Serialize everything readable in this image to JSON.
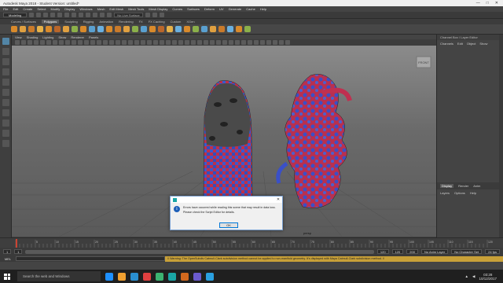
{
  "window": {
    "title": "Autodesk Maya 2018 - Student Version: untitled*",
    "controls": [
      "—",
      "□",
      "✕"
    ]
  },
  "menubar": {
    "items": [
      "File",
      "Edit",
      "Create",
      "Select",
      "Modify",
      "Display",
      "Windows",
      "Mesh",
      "Edit Mesh",
      "Mesh Tools",
      "Mesh Display",
      "Curves",
      "Surfaces",
      "Deform",
      "UV",
      "Generate",
      "Cache",
      "Help"
    ]
  },
  "statusline": {
    "mode": "Modeling",
    "live_surface": "No Live Surface"
  },
  "shelf": {
    "tabs": [
      "Curves / Surfaces",
      "Polygons",
      "Sculpting",
      "Rigging",
      "Animation",
      "Rendering",
      "FX",
      "FX Caching",
      "Custom",
      "XGen"
    ],
    "active_tab": "Polygons",
    "icon_colors": [
      "#d98a2b",
      "#e0a040",
      "#c97a2a",
      "#e6b24a",
      "#d98a2b",
      "#b9662a",
      "#e0a040",
      "#8bb04a",
      "#d98a2b",
      "#5aa0d0",
      "#6ab0e0",
      "#d98a2b",
      "#c97a2a",
      "#e0a040",
      "#8bb04a",
      "#5aa0d0",
      "#d98a2b",
      "#b9662a",
      "#e6b24a",
      "#6ab0e0",
      "#d98a2b",
      "#8bb04a",
      "#5aa0d0",
      "#e0a040",
      "#c97a2a",
      "#6ab0e0",
      "#d98a2b",
      "#8bb04a"
    ]
  },
  "viewport": {
    "menu": [
      "View",
      "Shading",
      "Lighting",
      "Show",
      "Renderer",
      "Panels"
    ],
    "camera_label": "persp",
    "view_cube": "FRONT"
  },
  "left_tools": [
    "select-tool",
    "lasso-tool",
    "paint-select-tool",
    "move-tool",
    "rotate-tool",
    "scale-tool",
    "last-tool",
    "layout-single",
    "layout-four",
    "layout-side",
    "layout-outliner"
  ],
  "right_panel": {
    "header": "Channel Box / Layer Editor",
    "menus": [
      "Channels",
      "Edit",
      "Object",
      "Show"
    ],
    "layer_tabs": [
      "Display",
      "Render",
      "Anim"
    ],
    "active_layer_tab": "Display",
    "layer_menus": [
      "Layers",
      "Options",
      "Help"
    ],
    "side_tabs": [
      "Channel Box / Layer Editor",
      "Modeling Toolkit",
      "Attribute Editor"
    ]
  },
  "timeline": {
    "ticks": [
      "5",
      "10",
      "15",
      "20",
      "25",
      "30",
      "35",
      "40",
      "45",
      "50",
      "55",
      "60",
      "65",
      "70",
      "75",
      "80",
      "85",
      "90",
      "95",
      "100",
      "105",
      "110",
      "115",
      "120"
    ],
    "current_frame": "1"
  },
  "range": {
    "start": "1",
    "inner_start": "1",
    "inner_end": "120",
    "end": "120",
    "end2": "200",
    "anim_layer": "No Anim Layer",
    "char_set": "No Character Set",
    "fps": "24 fps"
  },
  "cmdline": {
    "label": "MEL",
    "warning": "// Warning: The OpenSubdiv Catmull-Clark subdivision method cannot be applied to non-manifold geometry. It's displayed with Maya Catmull-Clark subdivision method. //"
  },
  "dialog": {
    "title": "",
    "message_line1": "Errors have occurred while reading this scene that may result in data loss.",
    "message_line2": "Please check the Script Editor for details.",
    "ok_label": "OK"
  },
  "taskbar": {
    "search_placeholder": "Search the web and Windows",
    "time": "03:28",
    "date": "10/12/2017",
    "app_colors": [
      "#1e90ff",
      "#f0a030",
      "#2a8fd0",
      "#e04040",
      "#3cb371",
      "#1aa5a5",
      "#d2691e",
      "#6a5acd",
      "#2aa0e0"
    ]
  }
}
